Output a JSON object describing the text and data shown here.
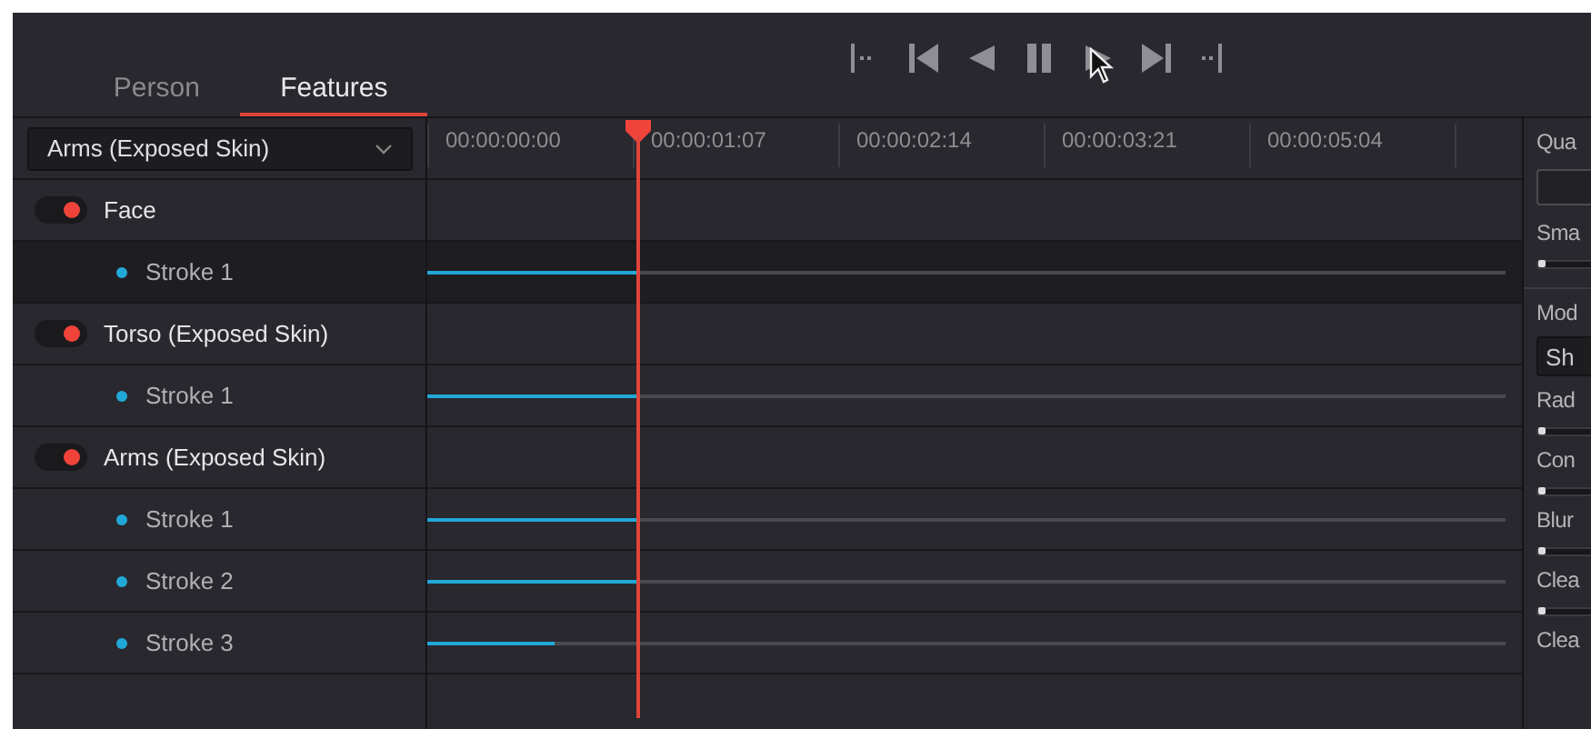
{
  "tabs": [
    {
      "label": "Person",
      "selected": false
    },
    {
      "label": "Features",
      "selected": true
    }
  ],
  "transport": [
    {
      "kind": "go-start"
    },
    {
      "kind": "jump-back"
    },
    {
      "kind": "reverse"
    },
    {
      "kind": "pause"
    },
    {
      "kind": "play"
    },
    {
      "kind": "jump-forward"
    },
    {
      "kind": "go-end"
    }
  ],
  "feature_dropdown": {
    "value": "Arms (Exposed Skin)"
  },
  "timecodes": [
    "00:00:00:00",
    "00:00:01:07",
    "00:00:02:14",
    "00:00:03:21",
    "00:00:05:04"
  ],
  "playhead": {
    "level": 0.196
  },
  "tracks": [
    {
      "name": "Face",
      "on": true,
      "children": [
        {
          "name": "Stroke 1",
          "selected": true,
          "level": 0.196
        }
      ]
    },
    {
      "name": "Torso (Exposed Skin)",
      "on": true,
      "children": [
        {
          "name": "Stroke 1",
          "selected": false,
          "level": 0.196
        }
      ]
    },
    {
      "name": "Arms (Exposed Skin)",
      "on": true,
      "children": [
        {
          "name": "Stroke 1",
          "selected": false,
          "level": 0.196
        },
        {
          "name": "Stroke 2",
          "selected": false,
          "level": 0.196
        },
        {
          "name": "Stroke 3",
          "selected": false,
          "level": 0.118
        }
      ]
    }
  ],
  "inspector": [
    {
      "kind": "label",
      "text": "Qua"
    },
    {
      "kind": "field"
    },
    {
      "kind": "label",
      "text": "Sma"
    },
    {
      "kind": "slider",
      "level": 0
    },
    {
      "kind": "divider"
    },
    {
      "kind": "label",
      "text": "Mod"
    },
    {
      "kind": "button",
      "text": "Sh"
    },
    {
      "kind": "label",
      "text": "Rad"
    },
    {
      "kind": "slider",
      "level": 0
    },
    {
      "kind": "label",
      "text": "Con"
    },
    {
      "kind": "slider",
      "level": 0
    },
    {
      "kind": "label",
      "text": "Blur"
    },
    {
      "kind": "slider",
      "level": 0
    },
    {
      "kind": "label",
      "text": "Clea"
    },
    {
      "kind": "slider",
      "level": 0
    },
    {
      "kind": "label",
      "text": "Clea"
    }
  ]
}
